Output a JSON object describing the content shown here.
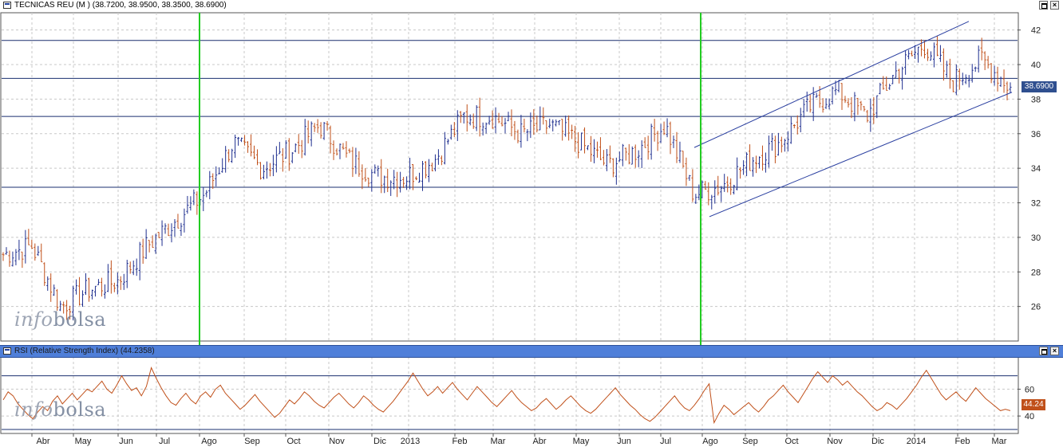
{
  "price_panel": {
    "title": "TECNICAS REU (M ) (38.7200, 38.9500, 38.3500, 38.6900)",
    "last_label": "38.6900",
    "logo_a": "info",
    "logo_b": "bolsa"
  },
  "rsi_panel": {
    "title": "RSI (Relative Strength Index) (44.2358)",
    "last_label": "44.24",
    "logo_a": "info",
    "logo_b": "bolsa"
  },
  "colors": {
    "bar_up": "#1f2f8f",
    "bar_down": "#c0501a",
    "rsi_line": "#c0501a",
    "h_lines": "#1a2f6f",
    "channel": "#2a3fa0",
    "green_markers": "#22cc22",
    "grid": "#c8c8c8",
    "header_blue": "#4f7fd9",
    "label_bg": "#2f4f8f"
  },
  "chart_data": [
    {
      "type": "ohlc",
      "title": "TECNICAS REU (M )",
      "ylim": [
        24,
        43
      ],
      "y_ticks": [
        26,
        28,
        30,
        32,
        34,
        36,
        38,
        40,
        42
      ],
      "months": [
        "Abr",
        "May",
        "Jun",
        "Jul",
        "Ago",
        "Sep",
        "Oct",
        "Nov",
        "Dic",
        "2013",
        "Feb",
        "Mar",
        "Abr",
        "May",
        "Jun",
        "Jul",
        "Ago",
        "Sep",
        "Oct",
        "Nov",
        "Dic",
        "2014",
        "Feb",
        "Mar"
      ],
      "horizontal_levels": [
        32.9,
        37.0,
        39.2,
        41.4
      ],
      "vertical_markers": [
        "Ago 2012",
        "Ago 2013"
      ],
      "price_path": [
        [
          "start",
          29.0
        ],
        [
          "Abr",
          29.5
        ],
        [
          "mid-Abr",
          26.0
        ],
        [
          "May",
          27.0
        ],
        [
          "Jun",
          27.5
        ],
        [
          "mid-Jun",
          29.5
        ],
        [
          "Jul",
          31.0
        ],
        [
          "end-Jul",
          32.5
        ],
        [
          "Ago",
          35.5
        ],
        [
          "Sep",
          34.0
        ],
        [
          "Oct",
          35.0
        ],
        [
          "mid-Oct",
          36.5
        ],
        [
          "Nov",
          34.5
        ],
        [
          "mid-Nov",
          33.5
        ],
        [
          "Dic",
          33.5
        ],
        [
          "2013",
          34.5
        ],
        [
          "Feb",
          37.0
        ],
        [
          "Mar",
          37.0
        ],
        [
          "Abr",
          36.0
        ],
        [
          "May",
          36.5
        ],
        [
          "Jun",
          35.5
        ],
        [
          "mid-Jun",
          34.2
        ],
        [
          "Jul",
          35.0
        ],
        [
          "end-Jul",
          36.5
        ],
        [
          "Ago",
          32.5
        ],
        [
          "Sep",
          33.0
        ],
        [
          "mid-Sep",
          34.5
        ],
        [
          "Oct",
          35.5
        ],
        [
          "mid-Oct",
          37.5
        ],
        [
          "Nov",
          38.5
        ],
        [
          "Dic",
          37.0
        ],
        [
          "2014",
          39.5
        ],
        [
          "mid-Ene",
          41.2
        ],
        [
          "Feb",
          39.0
        ],
        [
          "mid-Feb",
          40.3
        ],
        [
          "Mar",
          38.7
        ]
      ],
      "channel": {
        "lower_from": 31.2,
        "lower_to": 38.4,
        "upper_from": 35.2,
        "upper_to": 42.5
      },
      "last": 38.69
    },
    {
      "type": "line",
      "title": "RSI (Relative Strength Index)",
      "ylim": [
        27,
        84
      ],
      "y_ticks": [
        40,
        60
      ],
      "levels": [
        30,
        70
      ],
      "values": [
        52,
        58,
        55,
        49,
        45,
        41,
        38,
        43,
        47,
        44,
        51,
        55,
        49,
        53,
        57,
        52,
        56,
        60,
        58,
        62,
        66,
        60,
        57,
        63,
        70,
        64,
        59,
        61,
        55,
        62,
        76,
        68,
        61,
        55,
        50,
        48,
        53,
        57,
        52,
        49,
        55,
        58,
        54,
        60,
        63,
        57,
        53,
        49,
        45,
        48,
        52,
        56,
        51,
        47,
        43,
        39,
        42,
        47,
        52,
        49,
        53,
        58,
        55,
        51,
        48,
        46,
        50,
        54,
        57,
        53,
        49,
        46,
        50,
        55,
        52,
        48,
        45,
        43,
        47,
        51,
        56,
        61,
        66,
        72,
        66,
        60,
        55,
        58,
        62,
        57,
        61,
        65,
        60,
        56,
        52,
        57,
        62,
        58,
        54,
        50,
        47,
        51,
        55,
        59,
        54,
        50,
        47,
        44,
        46,
        50,
        53,
        49,
        45,
        48,
        52,
        55,
        51,
        47,
        44,
        42,
        45,
        49,
        53,
        57,
        61,
        56,
        52,
        48,
        45,
        41,
        38,
        36,
        39,
        43,
        47,
        51,
        55,
        50,
        46,
        44,
        48,
        53,
        59,
        64,
        35,
        42,
        48,
        45,
        41,
        44,
        47,
        50,
        46,
        43,
        47,
        52,
        55,
        59,
        63,
        58,
        54,
        50,
        56,
        62,
        68,
        73,
        69,
        65,
        70,
        67,
        63,
        66,
        62,
        58,
        55,
        51,
        47,
        44,
        46,
        50,
        48,
        45,
        49,
        53,
        58,
        63,
        69,
        74,
        68,
        62,
        56,
        52,
        55,
        58,
        54,
        51,
        56,
        61,
        57,
        53,
        50,
        47,
        44,
        45,
        44
      ],
      "last": 44.24
    }
  ]
}
